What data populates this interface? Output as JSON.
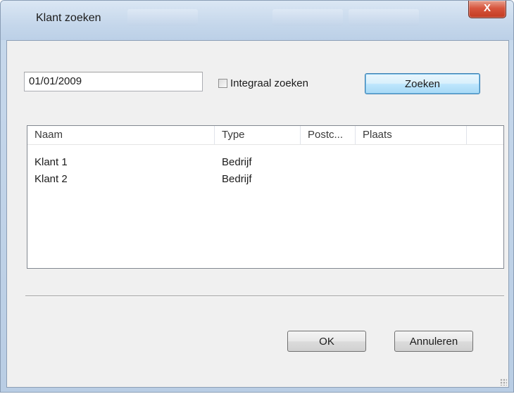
{
  "window": {
    "title": "Klant zoeken",
    "close_glyph": "X"
  },
  "search": {
    "date_value": "01/01/2009",
    "integraal_label": "Integraal zoeken",
    "integraal_checked": false,
    "zoeken_label": "Zoeken"
  },
  "list": {
    "columns": [
      "Naam",
      "Type",
      "Postc...",
      "Plaats"
    ],
    "rows": [
      {
        "naam": "Klant 1",
        "type": "Bedrijf",
        "postcode": "",
        "plaats": ""
      },
      {
        "naam": "Klant 2",
        "type": "Bedrijf",
        "postcode": "",
        "plaats": ""
      }
    ]
  },
  "footer": {
    "ok_label": "OK",
    "cancel_label": "Annuleren"
  },
  "icons": {
    "close": "close-icon",
    "checkbox": "checkbox-icon",
    "grip": "resize-grip-icon"
  },
  "colors": {
    "default_button_border": "#3c7fb1",
    "close_button": "#c23b22"
  }
}
